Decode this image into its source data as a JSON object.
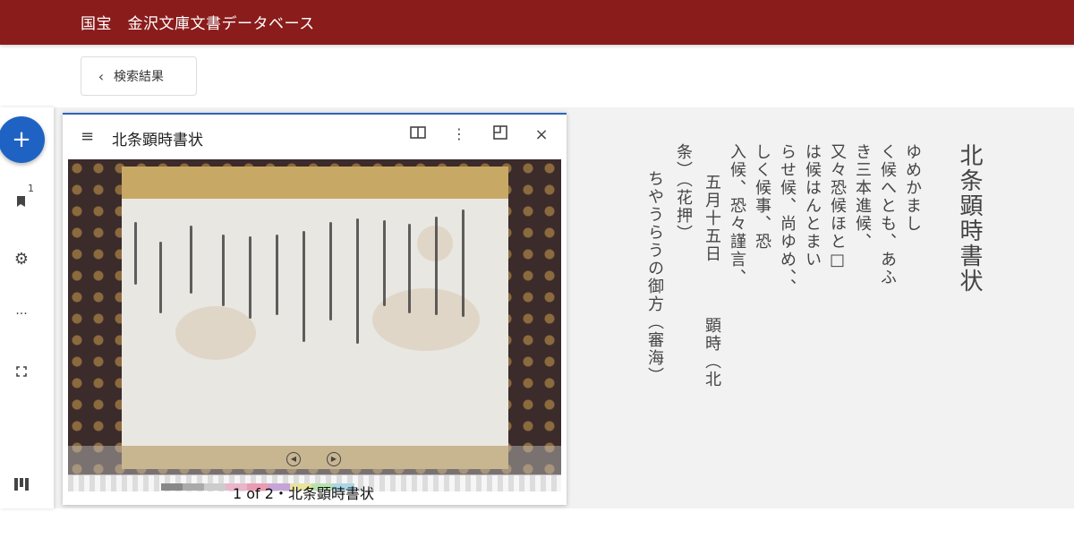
{
  "header": {
    "title": "国宝　金沢文庫文書データベース"
  },
  "back_button": {
    "label": "検索結果"
  },
  "rail": {
    "add_label": "+",
    "badge_count": "1"
  },
  "viewer": {
    "title": "北条顕時書状",
    "caption": "1 of 2・北条顕時書状"
  },
  "transcription": {
    "title": "北条顕時書状",
    "lines": [
      "ゆめかまし",
      "く候へとも、あふ",
      "き三本進候、",
      "又々恐候ほと□",
      "は候はんとまい",
      "らせ候、尚ゆめ、、",
      "しく候事、恐",
      "入候、恐々謹言、",
      "五月十五日　　　顕時（北",
      "条）（花押）",
      "ちやうらうの御方（審海）"
    ]
  }
}
